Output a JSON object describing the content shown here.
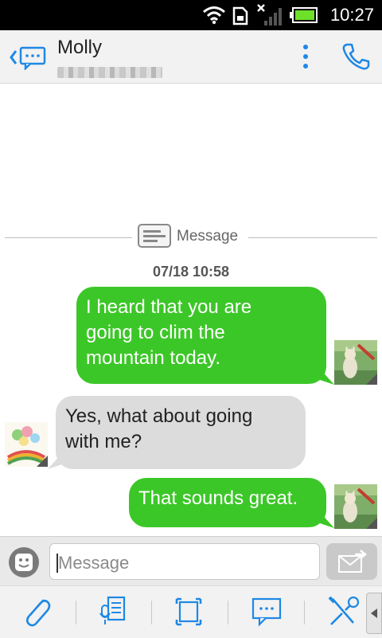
{
  "status_bar": {
    "time": "10:27"
  },
  "header": {
    "contact_name": "Molly"
  },
  "conversation": {
    "divider_label": "Message",
    "timestamp": "07/18 10:58",
    "messages": [
      {
        "direction": "outgoing",
        "lines": [
          "I heard that you are",
          "going to clim the",
          "mountain today."
        ]
      },
      {
        "direction": "incoming",
        "lines": [
          "Yes, what about going",
          "with me?"
        ]
      },
      {
        "direction": "outgoing",
        "lines": [
          "That sounds great."
        ]
      }
    ]
  },
  "composer": {
    "placeholder": "Message"
  },
  "toolbar": {
    "items": [
      "attach-icon",
      "notes-icon",
      "expand-icon",
      "quick-text-icon",
      "tools-icon",
      "more-arrow-icon"
    ]
  },
  "colors": {
    "accent": "#1e88e5",
    "outgoing_bubble": "#3cc728",
    "incoming_bubble": "#dcdcdc"
  }
}
